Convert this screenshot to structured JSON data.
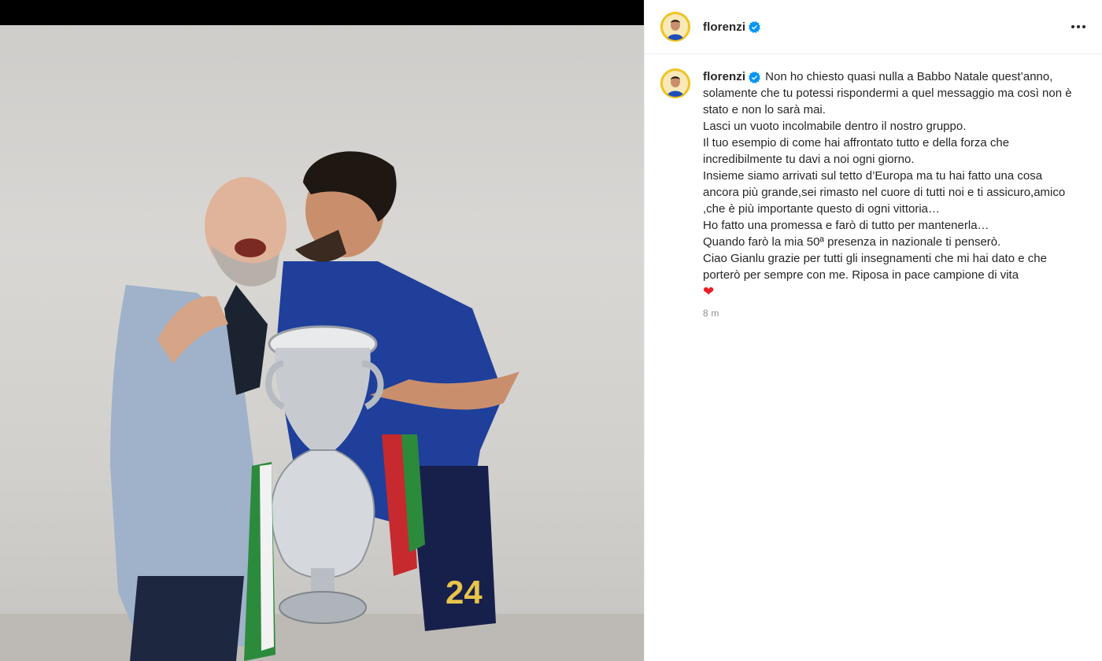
{
  "post": {
    "image_alt": "Photo of two men celebrating with the European Championship trophy",
    "jersey_number": "24"
  },
  "header": {
    "username": "florenzi",
    "verified_icon": "verified-badge-icon",
    "more_icon": "more-options-icon"
  },
  "caption": {
    "username": "florenzi",
    "lines": [
      "Non ho chiesto quasi nulla a Babbo Natale quest’anno, solamente che tu potessi rispondermi a quel messaggio ma così non è stato e non lo sarà mai.",
      "Lasci un vuoto incolmabile dentro il nostro gruppo.",
      "Il tuo esempio di come hai affrontato tutto e della forza che incredibilmente tu davi a noi ogni giorno.",
      "Insieme siamo arrivati sul tetto d’Europa ma tu hai fatto una cosa ancora più grande,sei rimasto nel cuore di tutti noi e ti assicuro,amico ,che è più importante questo di ogni vittoria…",
      "Ho fatto una promessa e farò di tutto per mantenerla…",
      "Quando farò la mia 50ª presenza in nazionale ti penserò.",
      "Ciao Gianlu grazie per tutti gli insegnamenti che mi hai dato e che porterò per sempre con me. Riposa in pace campione di vita"
    ],
    "heart": "❤",
    "timestamp": "8 m"
  },
  "colors": {
    "verified_blue": "#0095f6",
    "text": "#262626",
    "muted": "#8e8e8e",
    "heart_red": "#ed1c24"
  }
}
